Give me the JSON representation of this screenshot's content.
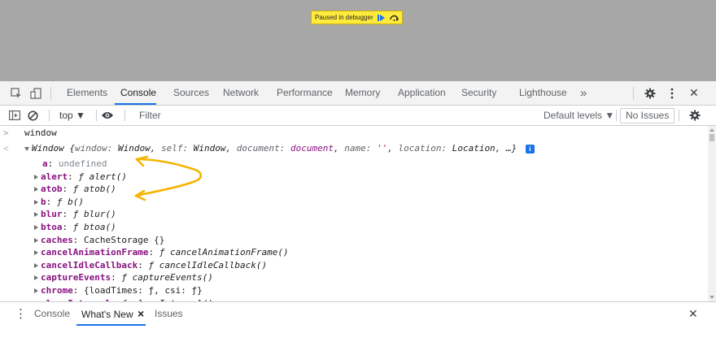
{
  "viewport": {
    "paused_text": "Paused in debugger",
    "resume_icon": "resume-icon",
    "step_over_icon": "step-over-icon",
    "background_color": "#a7a7a7",
    "banner_color": "#ffeb3b"
  },
  "tabbar": {
    "tabs": [
      {
        "label": "Elements"
      },
      {
        "label": "Console"
      },
      {
        "label": "Sources"
      },
      {
        "label": "Network"
      },
      {
        "label": "Performance"
      },
      {
        "label": "Memory"
      },
      {
        "label": "Application"
      },
      {
        "label": "Security"
      },
      {
        "label": "Lighthouse"
      }
    ],
    "active_tab": "Console",
    "more_tabs_glyph": "»",
    "close_glyph": "✕",
    "accent_color": "#1a73e8"
  },
  "toolbar": {
    "context": "top ▼",
    "filter_placeholder": "Filter",
    "filter_value": "",
    "levels_label": "Default levels ▼",
    "issues_label": "No Issues"
  },
  "console": {
    "input_command": "window",
    "input_prompt": ">",
    "result_prompt": "<",
    "summary": {
      "type": "Window",
      "preview": [
        {
          "key": "window",
          "sep": ": ",
          "value": "Window",
          "kind": "id",
          "trail": ", "
        },
        {
          "key": "self",
          "sep": ": ",
          "value": "Window",
          "kind": "id",
          "trail": ", "
        },
        {
          "key": "document",
          "sep": ": ",
          "value": "document",
          "kind": "obj",
          "trail": ", "
        },
        {
          "key": "name",
          "sep": ": ",
          "value": "''",
          "kind": "str",
          "trail": ", "
        },
        {
          "key": "location",
          "sep": ": ",
          "value": "Location",
          "kind": "id",
          "trail": ", "
        }
      ],
      "ellipsis": "…",
      "open_brace": "{",
      "close_brace": "}",
      "info_badge": "i"
    },
    "properties": [
      {
        "key": "a",
        "sep": ": ",
        "value": "undefined",
        "kind": "undefined",
        "expandable": false
      },
      {
        "key": "alert",
        "sep": ": ",
        "value": "ƒ alert()",
        "kind": "function",
        "expandable": true
      },
      {
        "key": "atob",
        "sep": ": ",
        "value": "ƒ atob()",
        "kind": "function",
        "expandable": true
      },
      {
        "key": "b",
        "sep": ": ",
        "value": "ƒ b()",
        "kind": "function",
        "expandable": true
      },
      {
        "key": "blur",
        "sep": ": ",
        "value": "ƒ blur()",
        "kind": "function",
        "expandable": true
      },
      {
        "key": "btoa",
        "sep": ": ",
        "value": "ƒ btoa()",
        "kind": "function",
        "expandable": true
      },
      {
        "key": "caches",
        "sep": ": ",
        "value": "CacheStorage {}",
        "kind": "object",
        "expandable": true
      },
      {
        "key": "cancelAnimationFrame",
        "sep": ": ",
        "value": "ƒ cancelAnimationFrame()",
        "kind": "function",
        "expandable": true
      },
      {
        "key": "cancelIdleCallback",
        "sep": ": ",
        "value": "ƒ cancelIdleCallback()",
        "kind": "function",
        "expandable": true
      },
      {
        "key": "captureEvents",
        "sep": ": ",
        "value": "ƒ captureEvents()",
        "kind": "function",
        "expandable": true
      },
      {
        "key": "chrome",
        "sep": ": ",
        "value": "{loadTimes: ƒ, csi: ƒ}",
        "kind": "object",
        "expandable": true
      },
      {
        "key": "clearInterval",
        "sep": ": ",
        "value": "ƒ clearInterval()",
        "kind": "function",
        "expandable": true
      }
    ]
  },
  "drawer": {
    "menu_glyph": "⋮",
    "tabs": [
      {
        "label": "Console"
      },
      {
        "label": "What's New"
      },
      {
        "label": "Issues"
      }
    ],
    "active_tab": "What's New",
    "tab_close_glyph": "×",
    "close_glyph": "✕"
  },
  "annotation": {
    "arrow_color": "#f5b400",
    "arrow_count": 2
  }
}
